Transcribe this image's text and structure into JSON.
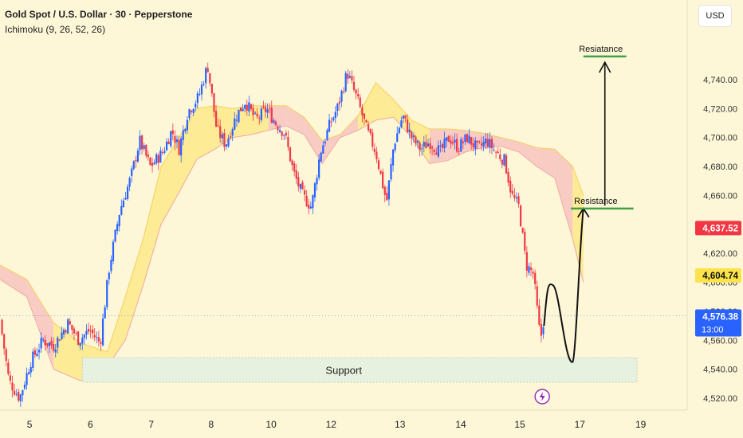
{
  "header": {
    "title": "Gold Spot / U.S. Dollar · 30 · Pepperstone",
    "indicator": "Ichimoku (9, 26, 52, 26)"
  },
  "currency_button": "USD",
  "colors": {
    "background": "#fdf7d8",
    "bull_candle": "#2962ff",
    "bear_candle": "#f23645",
    "cloud_bull": "#fde98a",
    "cloud_bear": "#f8c4c0",
    "support_zone": "#e6f2df",
    "level_line": "#43a047",
    "price_label_red": "#f23645",
    "price_label_yellow": "#fbe349",
    "price_label_blue": "#2962ff"
  },
  "chart_data": {
    "type": "candlestick",
    "symbol": "Gold Spot / U.S. Dollar",
    "timeframe": "30",
    "x_ticks": [
      "5",
      "6",
      "7",
      "8",
      "10",
      "12",
      "13",
      "14",
      "15",
      "17",
      "19"
    ],
    "y_ticks": [
      "4,740.00",
      "4,720.00",
      "4,700.00",
      "4,680.00",
      "4,660.00",
      "4,620.00",
      "4,600.00",
      "4,580.00",
      "4,560.00",
      "4,540.00",
      "4,520.00"
    ],
    "ylim": [
      4512,
      4765
    ],
    "price_path": [
      {
        "x": 0,
        "y": 4574
      },
      {
        "x": 0.5,
        "y": 4532
      },
      {
        "x": 1.1,
        "y": 4520
      },
      {
        "x": 1.7,
        "y": 4545
      },
      {
        "x": 2.4,
        "y": 4560
      },
      {
        "x": 3.0,
        "y": 4556
      },
      {
        "x": 3.8,
        "y": 4572
      },
      {
        "x": 4.4,
        "y": 4560
      },
      {
        "x": 5.0,
        "y": 4567
      },
      {
        "x": 5.6,
        "y": 4558
      },
      {
        "x": 6.1,
        "y": 4610
      },
      {
        "x": 6.7,
        "y": 4650
      },
      {
        "x": 7.3,
        "y": 4672
      },
      {
        "x": 7.8,
        "y": 4698
      },
      {
        "x": 8.4,
        "y": 4680
      },
      {
        "x": 9.1,
        "y": 4690
      },
      {
        "x": 9.6,
        "y": 4705
      },
      {
        "x": 10.0,
        "y": 4692
      },
      {
        "x": 10.5,
        "y": 4718
      },
      {
        "x": 11.1,
        "y": 4728
      },
      {
        "x": 11.6,
        "y": 4750
      },
      {
        "x": 12.1,
        "y": 4706
      },
      {
        "x": 12.6,
        "y": 4695
      },
      {
        "x": 13.2,
        "y": 4715
      },
      {
        "x": 13.7,
        "y": 4725
      },
      {
        "x": 14.3,
        "y": 4712
      },
      {
        "x": 14.9,
        "y": 4720
      },
      {
        "x": 15.4,
        "y": 4710
      },
      {
        "x": 15.9,
        "y": 4703
      },
      {
        "x": 16.4,
        "y": 4676
      },
      {
        "x": 16.9,
        "y": 4660
      },
      {
        "x": 17.4,
        "y": 4652
      },
      {
        "x": 17.9,
        "y": 4690
      },
      {
        "x": 18.4,
        "y": 4708
      },
      {
        "x": 18.9,
        "y": 4722
      },
      {
        "x": 19.4,
        "y": 4745
      },
      {
        "x": 20.0,
        "y": 4725
      },
      {
        "x": 20.5,
        "y": 4705
      },
      {
        "x": 21.0,
        "y": 4690
      },
      {
        "x": 21.6,
        "y": 4655
      },
      {
        "x": 22.0,
        "y": 4695
      },
      {
        "x": 22.5,
        "y": 4715
      },
      {
        "x": 23.0,
        "y": 4700
      },
      {
        "x": 23.5,
        "y": 4692
      },
      {
        "x": 24.0,
        "y": 4697
      },
      {
        "x": 24.6,
        "y": 4690
      },
      {
        "x": 25.1,
        "y": 4700
      },
      {
        "x": 25.6,
        "y": 4693
      },
      {
        "x": 26.1,
        "y": 4700
      },
      {
        "x": 26.7,
        "y": 4692
      },
      {
        "x": 27.2,
        "y": 4698
      },
      {
        "x": 27.7,
        "y": 4690
      },
      {
        "x": 28.2,
        "y": 4684
      },
      {
        "x": 28.6,
        "y": 4660
      },
      {
        "x": 29.0,
        "y": 4652
      },
      {
        "x": 29.4,
        "y": 4612
      },
      {
        "x": 29.8,
        "y": 4606
      },
      {
        "x": 30.2,
        "y": 4560
      },
      {
        "x": 30.4,
        "y": 4576
      }
    ],
    "cloud_upper": [
      {
        "x": 0,
        "y": 4612
      },
      {
        "x": 1.5,
        "y": 4602
      },
      {
        "x": 3.0,
        "y": 4572
      },
      {
        "x": 4.5,
        "y": 4558
      },
      {
        "x": 6.0,
        "y": 4552
      },
      {
        "x": 7.0,
        "y": 4590
      },
      {
        "x": 8.0,
        "y": 4630
      },
      {
        "x": 9.0,
        "y": 4680
      },
      {
        "x": 10.0,
        "y": 4700
      },
      {
        "x": 11.0,
        "y": 4720
      },
      {
        "x": 12.0,
        "y": 4722
      },
      {
        "x": 13.0,
        "y": 4720
      },
      {
        "x": 14.0,
        "y": 4722
      },
      {
        "x": 15.0,
        "y": 4722
      },
      {
        "x": 16.0,
        "y": 4722
      },
      {
        "x": 17.0,
        "y": 4714
      },
      {
        "x": 18.0,
        "y": 4698
      },
      {
        "x": 19.0,
        "y": 4702
      },
      {
        "x": 20.0,
        "y": 4715
      },
      {
        "x": 21.0,
        "y": 4738
      },
      {
        "x": 22.0,
        "y": 4726
      },
      {
        "x": 23.0,
        "y": 4712
      },
      {
        "x": 24.0,
        "y": 4706
      },
      {
        "x": 25.0,
        "y": 4706
      },
      {
        "x": 26.0,
        "y": 4705
      },
      {
        "x": 27.0,
        "y": 4703
      },
      {
        "x": 28.0,
        "y": 4700
      },
      {
        "x": 29.0,
        "y": 4697
      },
      {
        "x": 30.0,
        "y": 4693
      },
      {
        "x": 31.0,
        "y": 4692
      },
      {
        "x": 32.0,
        "y": 4680
      },
      {
        "x": 32.6,
        "y": 4660
      }
    ],
    "cloud_lower": [
      {
        "x": 0,
        "y": 4602
      },
      {
        "x": 1.5,
        "y": 4590
      },
      {
        "x": 3.0,
        "y": 4540
      },
      {
        "x": 4.5,
        "y": 4532
      },
      {
        "x": 6.0,
        "y": 4542
      },
      {
        "x": 7.0,
        "y": 4560
      },
      {
        "x": 8.0,
        "y": 4598
      },
      {
        "x": 9.0,
        "y": 4640
      },
      {
        "x": 10.0,
        "y": 4662
      },
      {
        "x": 11.0,
        "y": 4685
      },
      {
        "x": 12.0,
        "y": 4692
      },
      {
        "x": 13.0,
        "y": 4700
      },
      {
        "x": 14.0,
        "y": 4702
      },
      {
        "x": 15.0,
        "y": 4705
      },
      {
        "x": 16.0,
        "y": 4708
      },
      {
        "x": 17.0,
        "y": 4702
      },
      {
        "x": 18.0,
        "y": 4682
      },
      {
        "x": 19.0,
        "y": 4700
      },
      {
        "x": 20.0,
        "y": 4705
      },
      {
        "x": 21.0,
        "y": 4712
      },
      {
        "x": 22.0,
        "y": 4714
      },
      {
        "x": 23.0,
        "y": 4700
      },
      {
        "x": 24.0,
        "y": 4682
      },
      {
        "x": 25.0,
        "y": 4684
      },
      {
        "x": 26.0,
        "y": 4690
      },
      {
        "x": 27.0,
        "y": 4693
      },
      {
        "x": 28.0,
        "y": 4694
      },
      {
        "x": 29.0,
        "y": 4690
      },
      {
        "x": 30.0,
        "y": 4680
      },
      {
        "x": 31.0,
        "y": 4672
      },
      {
        "x": 32.0,
        "y": 4630
      },
      {
        "x": 32.6,
        "y": 4600
      }
    ],
    "support_zone": {
      "label": "Support",
      "y_from": 4531,
      "y_to": 4548,
      "x_from": 4.6,
      "x_to": 35.6
    },
    "levels": [
      {
        "label": "Resistance",
        "price": 4651,
        "x_from": 31.9,
        "x_to": 35.4
      },
      {
        "label": "Resiatance",
        "price": 4756,
        "x_from": 32.6,
        "x_to": 35.0
      }
    ],
    "projection_path": [
      {
        "x": 30.4,
        "y": 4570
      },
      {
        "x": 30.9,
        "y": 4598
      },
      {
        "x": 31.4,
        "y": 4560
      },
      {
        "x": 32.0,
        "y": 4545
      },
      {
        "x": 32.4,
        "y": 4640
      },
      {
        "x": 32.6,
        "y": 4651
      }
    ],
    "second_arrow": {
      "x": 33.8,
      "from": 4653,
      "to": 4752
    },
    "price_labels": [
      {
        "text": "4,637.52",
        "price": 4637.52,
        "style": "red"
      },
      {
        "text": "4,604.74",
        "price": 4604.74,
        "style": "yellow"
      },
      {
        "text": "4,576.38",
        "price": 4576.38,
        "style": "blue",
        "sub": "13:00"
      }
    ],
    "current_price_line": 4577
  }
}
